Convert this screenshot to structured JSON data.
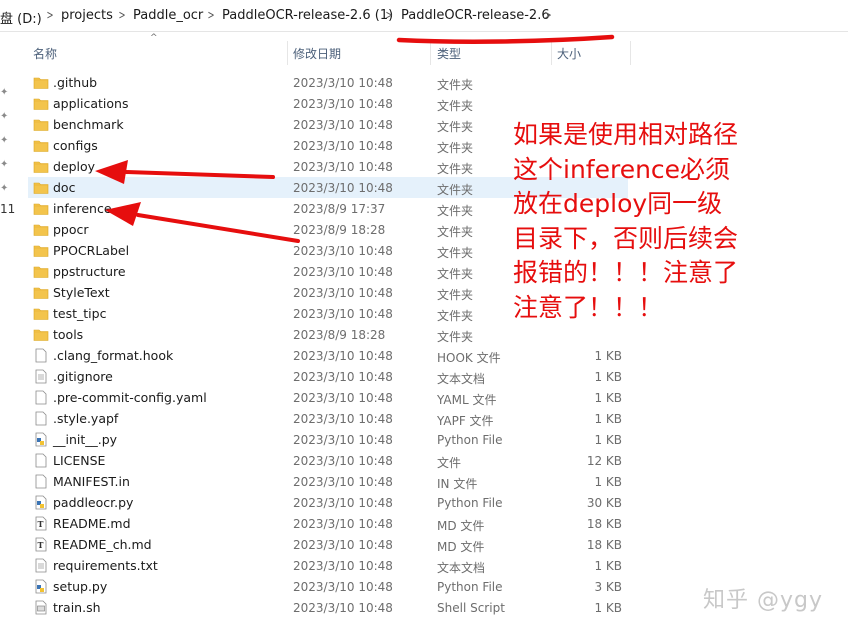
{
  "breadcrumb": [
    "盘 (D:)",
    "projects",
    "Paddle_ocr",
    "PaddleOCR-release-2.6 (1)",
    "PaddleOCR-release-2.6"
  ],
  "nav_side_label": "11",
  "columns": {
    "name": "名称",
    "date": "修改日期",
    "type": "类型",
    "size": "大小"
  },
  "files": [
    {
      "name": ".github",
      "date": "2023/3/10 10:48",
      "type": "文件夹",
      "size": "",
      "icon": "folder-icon"
    },
    {
      "name": "applications",
      "date": "2023/3/10 10:48",
      "type": "文件夹",
      "size": "",
      "icon": "folder-icon"
    },
    {
      "name": "benchmark",
      "date": "2023/3/10 10:48",
      "type": "文件夹",
      "size": "",
      "icon": "folder-icon"
    },
    {
      "name": "configs",
      "date": "2023/3/10 10:48",
      "type": "文件夹",
      "size": "",
      "icon": "folder-icon"
    },
    {
      "name": "deploy",
      "date": "2023/3/10 10:48",
      "type": "文件夹",
      "size": "",
      "icon": "folder-icon"
    },
    {
      "name": "doc",
      "date": "2023/3/10 10:48",
      "type": "文件夹",
      "size": "",
      "icon": "folder-icon",
      "selected": true
    },
    {
      "name": "inference",
      "date": "2023/8/9 17:37",
      "type": "文件夹",
      "size": "",
      "icon": "folder-icon"
    },
    {
      "name": "ppocr",
      "date": "2023/8/9 18:28",
      "type": "文件夹",
      "size": "",
      "icon": "folder-icon"
    },
    {
      "name": "PPOCRLabel",
      "date": "2023/3/10 10:48",
      "type": "文件夹",
      "size": "",
      "icon": "folder-icon"
    },
    {
      "name": "ppstructure",
      "date": "2023/3/10 10:48",
      "type": "文件夹",
      "size": "",
      "icon": "folder-icon"
    },
    {
      "name": "StyleText",
      "date": "2023/3/10 10:48",
      "type": "文件夹",
      "size": "",
      "icon": "folder-icon"
    },
    {
      "name": "test_tipc",
      "date": "2023/3/10 10:48",
      "type": "文件夹",
      "size": "",
      "icon": "folder-icon"
    },
    {
      "name": "tools",
      "date": "2023/8/9 18:28",
      "type": "文件夹",
      "size": "",
      "icon": "folder-icon"
    },
    {
      "name": ".clang_format.hook",
      "date": "2023/3/10 10:48",
      "type": "HOOK 文件",
      "size": "1 KB",
      "icon": "file-icon"
    },
    {
      "name": ".gitignore",
      "date": "2023/3/10 10:48",
      "type": "文本文档",
      "size": "1 KB",
      "icon": "text-file-icon"
    },
    {
      "name": ".pre-commit-config.yaml",
      "date": "2023/3/10 10:48",
      "type": "YAML 文件",
      "size": "1 KB",
      "icon": "file-icon"
    },
    {
      "name": ".style.yapf",
      "date": "2023/3/10 10:48",
      "type": "YAPF 文件",
      "size": "1 KB",
      "icon": "file-icon"
    },
    {
      "name": "__init__.py",
      "date": "2023/3/10 10:48",
      "type": "Python File",
      "size": "1 KB",
      "icon": "python-file-icon"
    },
    {
      "name": "LICENSE",
      "date": "2023/3/10 10:48",
      "type": "文件",
      "size": "12 KB",
      "icon": "file-icon"
    },
    {
      "name": "MANIFEST.in",
      "date": "2023/3/10 10:48",
      "type": "IN 文件",
      "size": "1 KB",
      "icon": "file-icon"
    },
    {
      "name": "paddleocr.py",
      "date": "2023/3/10 10:48",
      "type": "Python File",
      "size": "30 KB",
      "icon": "python-file-icon"
    },
    {
      "name": "README.md",
      "date": "2023/3/10 10:48",
      "type": "MD 文件",
      "size": "18 KB",
      "icon": "markdown-file-icon"
    },
    {
      "name": "README_ch.md",
      "date": "2023/3/10 10:48",
      "type": "MD 文件",
      "size": "18 KB",
      "icon": "markdown-file-icon"
    },
    {
      "name": "requirements.txt",
      "date": "2023/3/10 10:48",
      "type": "文本文档",
      "size": "1 KB",
      "icon": "text-file-icon"
    },
    {
      "name": "setup.py",
      "date": "2023/3/10 10:48",
      "type": "Python File",
      "size": "3 KB",
      "icon": "python-file-icon"
    },
    {
      "name": "train.sh",
      "date": "2023/3/10 10:48",
      "type": "Shell Script",
      "size": "1 KB",
      "icon": "shell-script-icon"
    }
  ],
  "annotation": {
    "lines": [
      "如果是使用相对路径",
      "这个inference必须",
      "放在deploy同一级",
      "目录下，否则后续会",
      "报错的！！！注意了",
      "注意了！！！"
    ],
    "color": "#e60e0e"
  },
  "watermark": "知乎 @ygy",
  "colors": {
    "folder": "#f3c44c",
    "selection": "#e5f1fb",
    "header_text": "#4c607a"
  }
}
